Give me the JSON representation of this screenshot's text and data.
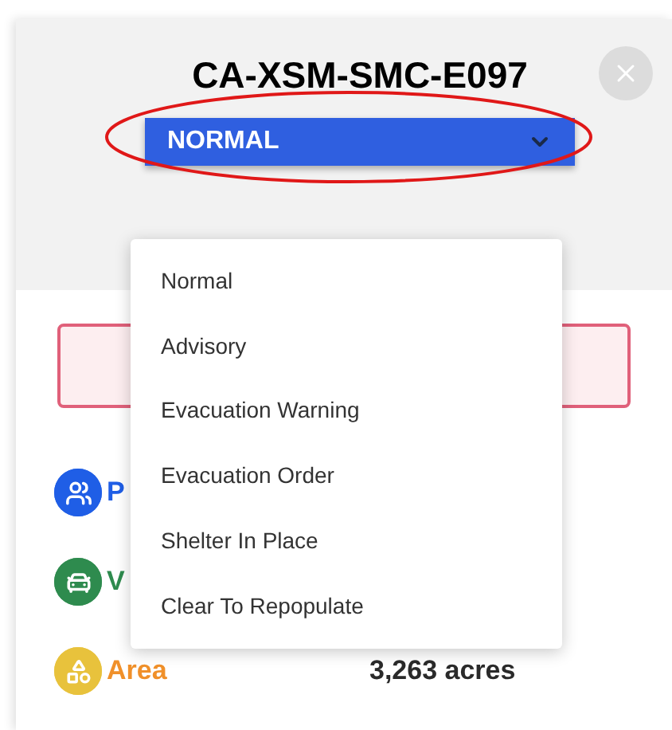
{
  "header": {
    "title": "CA-XSM-SMC-E097",
    "status_select": {
      "value": "NORMAL",
      "open": true
    }
  },
  "status_menu": [
    "Normal",
    "Advisory",
    "Evacuation Warning",
    "Evacuation Order",
    "Shelter In Place",
    "Clear To Repopulate"
  ],
  "stats": [
    {
      "kind": "people",
      "label": "P",
      "color": "#1f5ee6"
    },
    {
      "kind": "vehicles",
      "label": "V",
      "color": "#2e8b4e"
    },
    {
      "kind": "area",
      "label": "Area",
      "value": "3,263 acres",
      "color": "#e8c23c"
    }
  ]
}
